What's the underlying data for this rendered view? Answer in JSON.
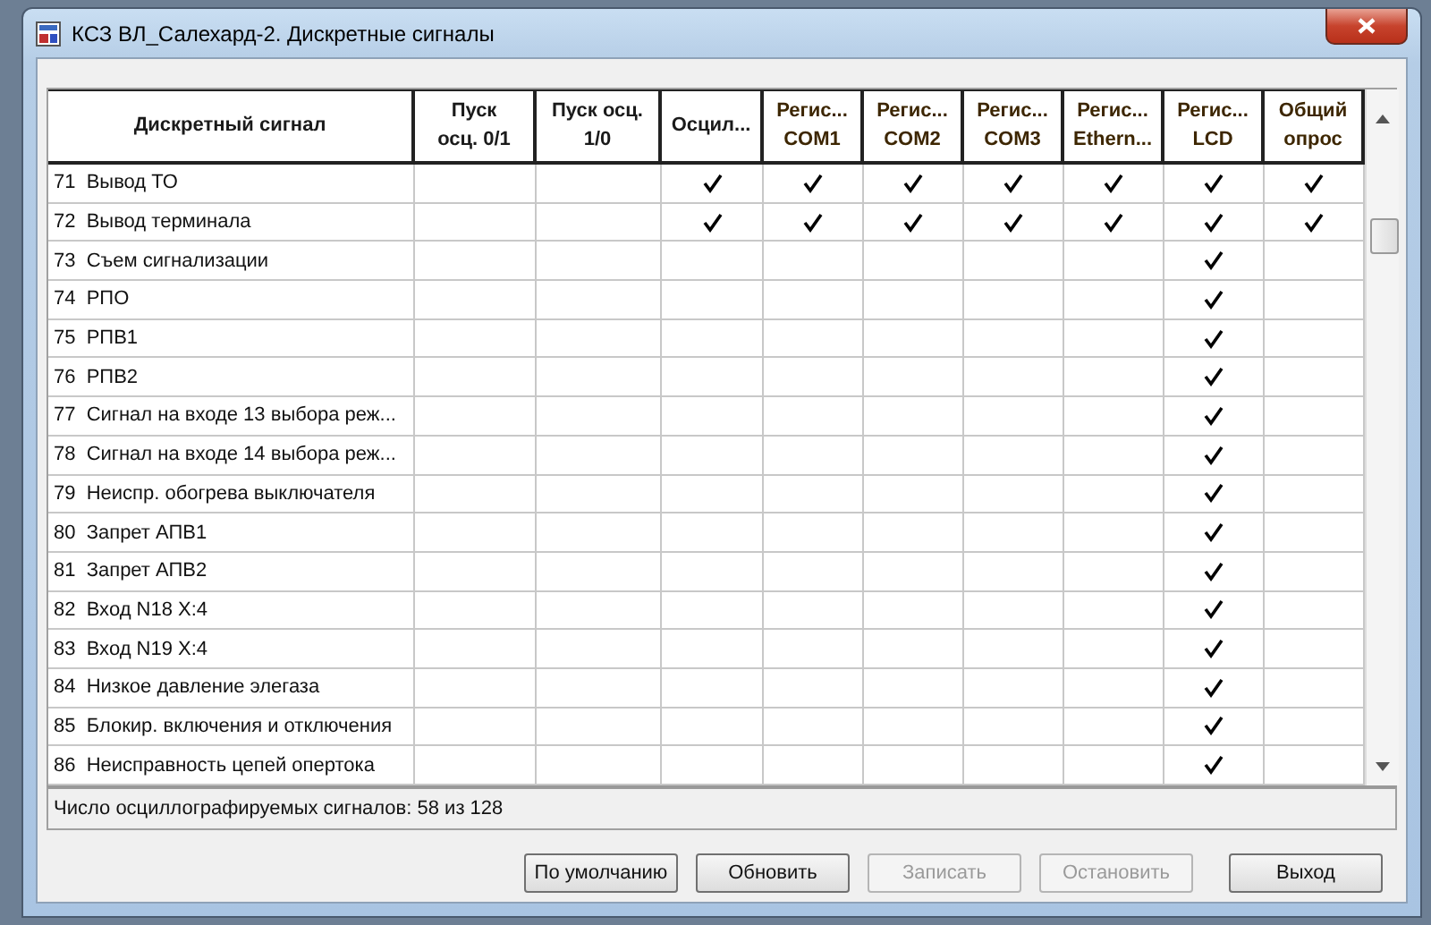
{
  "window": {
    "title": "КСЗ ВЛ_Салехард-2. Дискретные сигналы"
  },
  "table": {
    "columns": [
      "Дискретный сигнал",
      "Пуск осц. 0/1",
      "Пуск осц. 1/0",
      "Осцил...",
      "Регис... COM1",
      "Регис... COM2",
      "Регис... COM3",
      "Регис... Ethern...",
      "Регис... LCD",
      "Общий опрос"
    ],
    "rows": [
      {
        "signal": "71  Вывод ТО",
        "cells": [
          false,
          false,
          true,
          true,
          true,
          true,
          true,
          true,
          true
        ]
      },
      {
        "signal": "72  Вывод терминала",
        "cells": [
          false,
          false,
          true,
          true,
          true,
          true,
          true,
          true,
          true
        ]
      },
      {
        "signal": "73  Съем сигнализации",
        "cells": [
          false,
          false,
          false,
          false,
          false,
          false,
          false,
          true,
          false
        ]
      },
      {
        "signal": "74  РПО",
        "cells": [
          false,
          false,
          false,
          false,
          false,
          false,
          false,
          true,
          false
        ]
      },
      {
        "signal": "75  РПВ1",
        "cells": [
          false,
          false,
          false,
          false,
          false,
          false,
          false,
          true,
          false
        ]
      },
      {
        "signal": "76  РПВ2",
        "cells": [
          false,
          false,
          false,
          false,
          false,
          false,
          false,
          true,
          false
        ]
      },
      {
        "signal": "77  Сигнал на входе 13 выбора реж...",
        "cells": [
          false,
          false,
          false,
          false,
          false,
          false,
          false,
          true,
          false
        ]
      },
      {
        "signal": "78  Сигнал на входе 14 выбора реж...",
        "cells": [
          false,
          false,
          false,
          false,
          false,
          false,
          false,
          true,
          false
        ]
      },
      {
        "signal": "79  Неиспр. обогрева выключателя",
        "cells": [
          false,
          false,
          false,
          false,
          false,
          false,
          false,
          true,
          false
        ]
      },
      {
        "signal": "80  Запрет АПВ1",
        "cells": [
          false,
          false,
          false,
          false,
          false,
          false,
          false,
          true,
          false
        ]
      },
      {
        "signal": "81  Запрет АПВ2",
        "cells": [
          false,
          false,
          false,
          false,
          false,
          false,
          false,
          true,
          false
        ]
      },
      {
        "signal": "82  Вход N18 X:4",
        "cells": [
          false,
          false,
          false,
          false,
          false,
          false,
          false,
          true,
          false
        ]
      },
      {
        "signal": "83  Вход N19 X:4",
        "cells": [
          false,
          false,
          false,
          false,
          false,
          false,
          false,
          true,
          false
        ]
      },
      {
        "signal": "84  Низкое давление элегаза",
        "cells": [
          false,
          false,
          false,
          false,
          false,
          false,
          false,
          true,
          false
        ]
      },
      {
        "signal": "85  Блокир. включения и отключения",
        "cells": [
          false,
          false,
          false,
          false,
          false,
          false,
          false,
          true,
          false
        ]
      },
      {
        "signal": "86  Неисправность цепей опертока",
        "cells": [
          false,
          false,
          false,
          false,
          false,
          false,
          false,
          true,
          false
        ]
      }
    ]
  },
  "status_bar": "Число осциллографируемых сигналов: 58 из 128",
  "buttons": [
    {
      "label": "По умолчанию",
      "disabled": false
    },
    {
      "label": "Обновить",
      "disabled": false
    },
    {
      "label": "Записать",
      "disabled": true
    },
    {
      "label": "Остановить",
      "disabled": true
    },
    {
      "label": "Выход",
      "disabled": false
    }
  ]
}
